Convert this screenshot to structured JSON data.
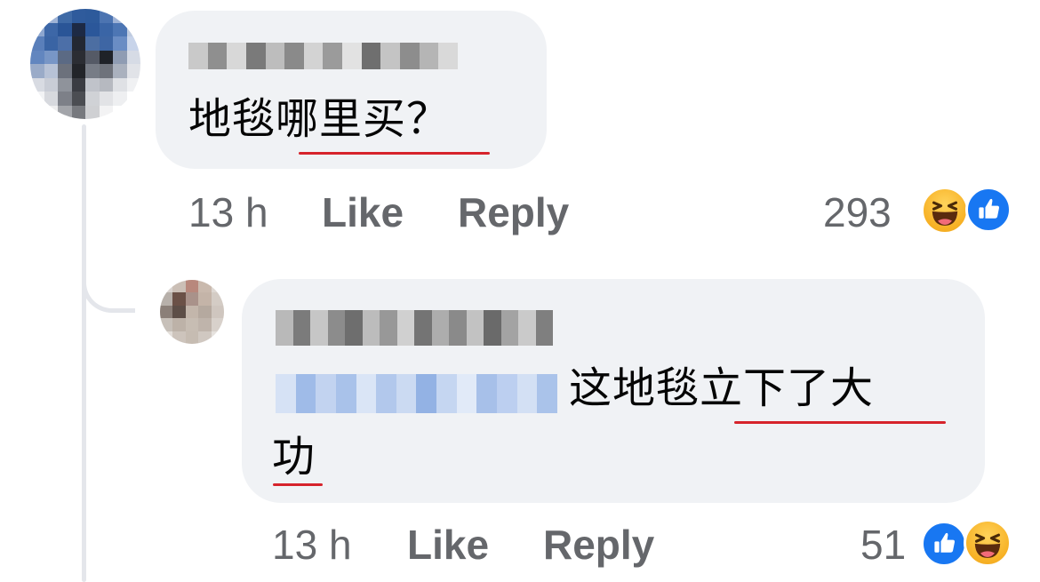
{
  "comments": [
    {
      "text": "地毯哪里买？",
      "time": "13 h",
      "like_label": "Like",
      "reply_label": "Reply",
      "reaction_count": "293",
      "reactions": [
        "haha-icon",
        "like-icon"
      ]
    },
    {
      "text_part1": "这地毯立下了大",
      "text_part2": "功",
      "time": "13 h",
      "like_label": "Like",
      "reply_label": "Reply",
      "reaction_count": "51",
      "reactions": [
        "like-icon",
        "haha-icon"
      ]
    }
  ],
  "colors": {
    "bubble": "#f0f2f5",
    "secondary_text": "#65676b",
    "underline": "#d6232b",
    "like_blue": "#1877f2",
    "haha_yellow": "#f7b125"
  }
}
